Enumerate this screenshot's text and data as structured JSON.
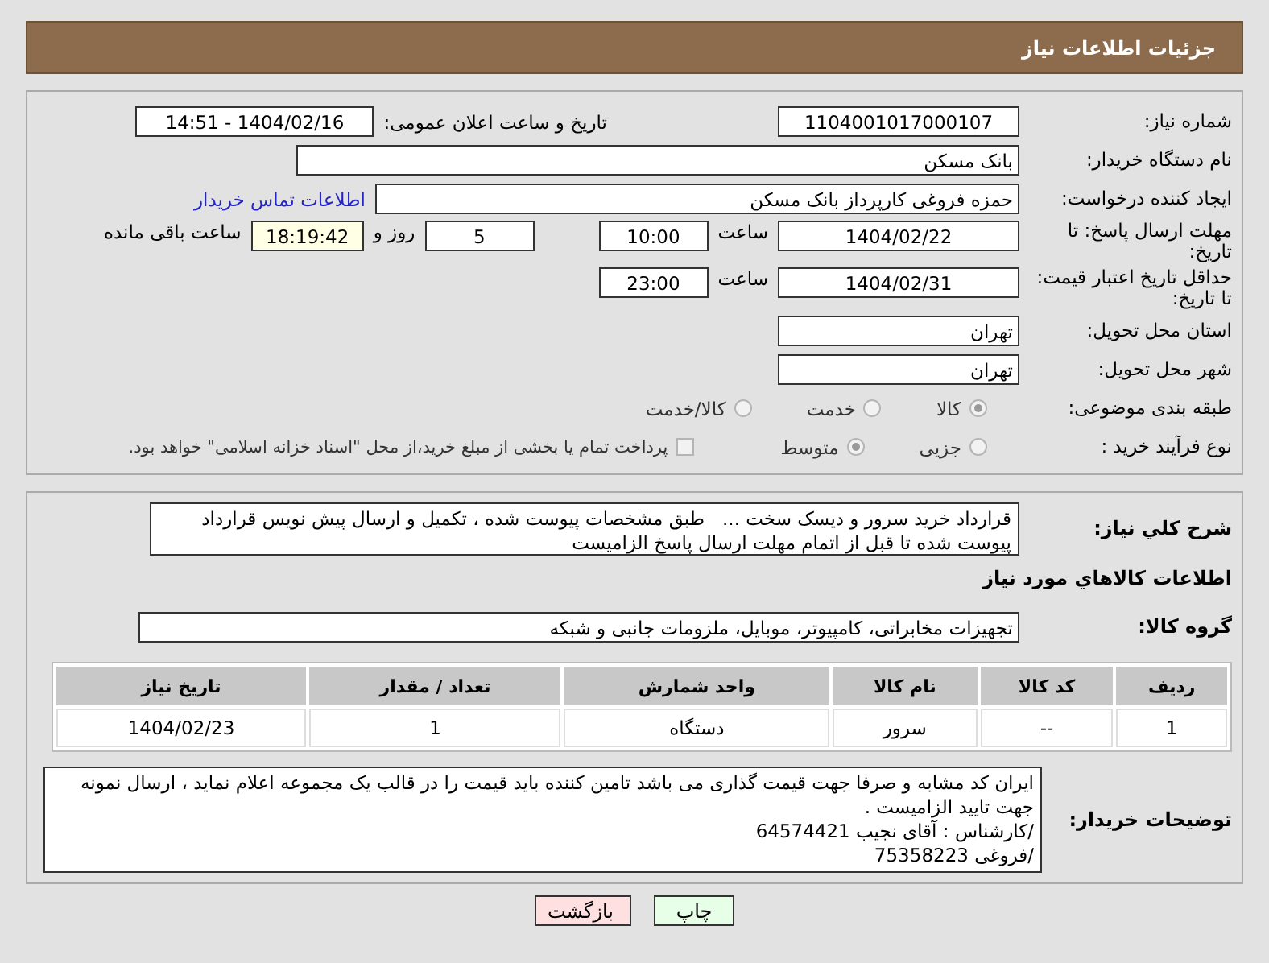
{
  "title": "جزئیات اطلاعات نیاز",
  "need_number": {
    "label": "شماره نیاز:",
    "value": "1104001017000107"
  },
  "announce": {
    "label": "تاریخ و ساعت اعلان عمومی:",
    "value": "1404/02/16 - 14:51"
  },
  "buyer_org": {
    "label": "نام دستگاه خریدار:",
    "value": "بانک مسکن"
  },
  "requester": {
    "label": "ایجاد کننده درخواست:",
    "value": "حمزه فروغی کارپرداز بانک مسکن",
    "link": "اطلاعات تماس خریدار"
  },
  "reply_deadline": {
    "label": "مهلت ارسال پاسخ: تا تاریخ:",
    "date": "1404/02/22",
    "time_label": "ساعت",
    "time": "10:00",
    "days": "5",
    "days_label": "روز و",
    "remaining": "18:19:42",
    "remaining_label": "ساعت باقی مانده"
  },
  "price_validity": {
    "label": "حداقل تاریخ اعتبار قیمت: تا تاریخ:",
    "date": "1404/02/31",
    "time_label": "ساعت",
    "time": "23:00"
  },
  "province": {
    "label": "استان محل تحویل:",
    "value": "تهران"
  },
  "city": {
    "label": "شهر محل تحویل:",
    "value": "تهران"
  },
  "category": {
    "label": "طبقه بندی موضوعی:",
    "options": [
      {
        "label": "کالا",
        "selected": true
      },
      {
        "label": "خدمت",
        "selected": false
      },
      {
        "label": "کالا/خدمت",
        "selected": false
      }
    ]
  },
  "process": {
    "label": "نوع فرآیند خرید :",
    "options": [
      {
        "label": "جزیی",
        "selected": false
      },
      {
        "label": "متوسط",
        "selected": true
      }
    ],
    "treasury": {
      "label": "پرداخت تمام یا بخشی از مبلغ خرید،از محل \"اسناد خزانه اسلامی\" خواهد بود.",
      "checked": false
    }
  },
  "description": {
    "label": "شرح کلي نیاز:",
    "value": "قرارداد خرید سرور و دیسک سخت ...   طبق مشخصات پیوست شده ، تکمیل و ارسال پیش نویس قرارداد پیوست شده تا قبل از اتمام مهلت ارسال پاسخ الزامیست"
  },
  "goods_heading": "اطلاعات کالاهاي مورد نیاز",
  "goods_group": {
    "label": "گروه کالا:",
    "value": "تجهیزات مخابراتی، کامپیوتر، موبایل، ملزومات جانبی و شبکه"
  },
  "table": {
    "columns": [
      "ردیف",
      "کد کالا",
      "نام کالا",
      "واحد شمارش",
      "تعداد / مقدار",
      "تاریخ نیاز"
    ],
    "rows": [
      [
        "1",
        "--",
        "سرور",
        "دستگاه",
        "1",
        "1404/02/23"
      ]
    ]
  },
  "buyer_notes": {
    "label": "توضیحات خریدار:",
    "value": "ایران کد مشابه و صرفا جهت قیمت گذاری می باشد تامین کننده باید قیمت را در قالب یک مجموعه اعلام نماید ، ارسال نمونه جهت تایید الزامیست .\n/کارشناس : آقای نجیب 64574421\n/فروغی 75358223"
  },
  "buttons": [
    {
      "label": "چاپ",
      "kind": "print"
    },
    {
      "label": "بازگشت",
      "kind": "back"
    }
  ]
}
